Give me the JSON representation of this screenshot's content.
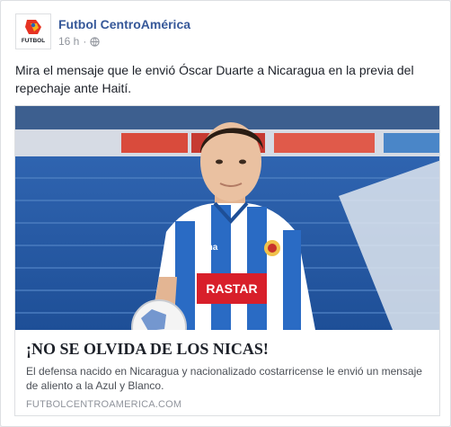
{
  "post": {
    "page_name": "Futbol CentroAmérica",
    "avatar_text": "FUTBOL",
    "time": "16 h",
    "separator": "·",
    "privacy_icon": "globe-icon",
    "text": "Mira el mensaje que le envió Óscar Duarte a Nicaragua en la previa del repechaje ante Haití."
  },
  "attachment": {
    "image_description_icon": "player-photo",
    "shirt_brand": "joma",
    "shirt_sponsor": "RASTAR",
    "title": "¡NO SE OLVIDA DE LOS NICAS!",
    "description": "El defensa nacido en Nicaragua y nacionalizado costarricense le envió un mensaje de aliento a la Azul y Blanco.",
    "domain": "FUTBOLCENTROAMERICA.COM"
  },
  "colors": {
    "page_name": "#365899",
    "meta": "#90949c",
    "shirt_blue": "#2a6bc4",
    "sponsor_red": "#d81f2a"
  }
}
